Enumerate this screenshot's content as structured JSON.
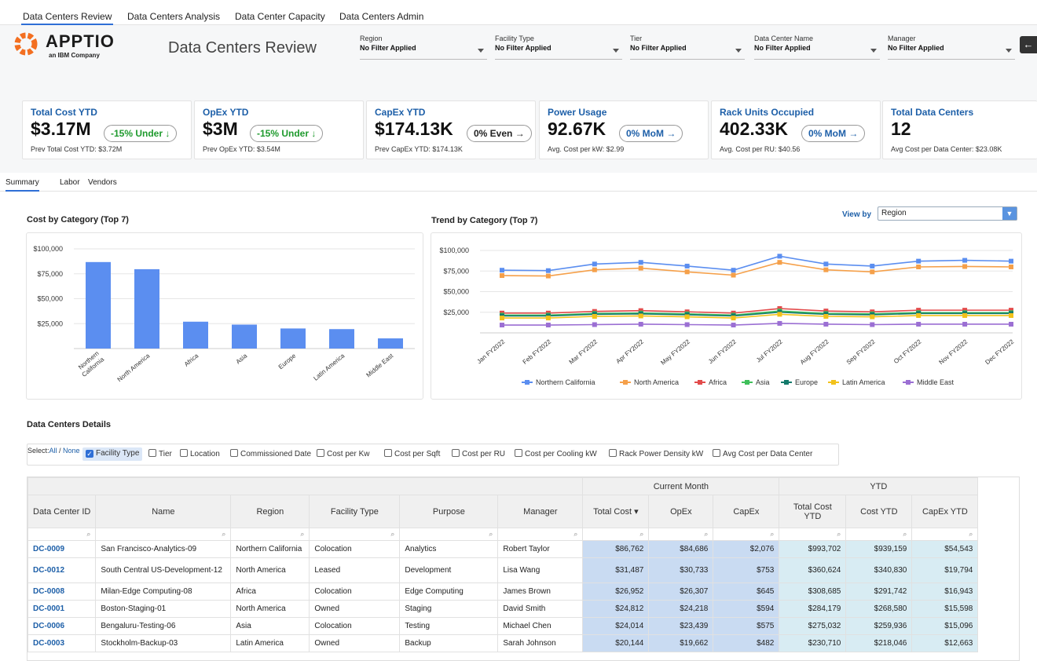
{
  "topnav": {
    "tabs": [
      "Data Centers Review",
      "Data Centers Analysis",
      "Data Center Capacity",
      "Data Centers Admin"
    ],
    "active_index": 0
  },
  "header": {
    "logo_text": "APPTIO",
    "logo_sub": "an IBM Company",
    "title": "Data Centers Review"
  },
  "filters": [
    {
      "label": "Region",
      "value": "No Filter Applied"
    },
    {
      "label": "Facility Type",
      "value": "No Filter Applied"
    },
    {
      "label": "Tier",
      "value": "No Filter Applied"
    },
    {
      "label": "Data Center Name",
      "value": "No Filter Applied"
    },
    {
      "label": "Manager",
      "value": "No Filter Applied"
    }
  ],
  "kpis": [
    {
      "title": "Total Cost YTD",
      "value": "$3.17M",
      "badge": "-15% Under ↓",
      "badge_color": "#1e9a2d",
      "sub": "Prev Total Cost YTD: $3.72M"
    },
    {
      "title": "OpEx YTD",
      "value": "$3M",
      "badge": "-15% Under ↓",
      "badge_color": "#1e9a2d",
      "sub": "Prev OpEx YTD: $3.54M"
    },
    {
      "title": "CapEx YTD",
      "value": "$174.13K",
      "badge": "0% Even →",
      "badge_color": "#222222",
      "sub": "Prev CapEx YTD: $174.13K"
    },
    {
      "title": "Power Usage",
      "value": "92.67K",
      "badge": "0% MoM →",
      "badge_color": "#1d5fa8",
      "sub": "Avg. Cost per kW: $2.99"
    },
    {
      "title": "Rack Units Occupied",
      "value": "402.33K",
      "badge": "0% MoM →",
      "badge_color": "#1d5fa8",
      "sub": "Avg. Cost per RU: $40.56"
    },
    {
      "title": "Total Data Centers",
      "value": "12",
      "badge": "",
      "badge_color": "#222222",
      "sub": "Avg Cost per Data Center: $23.08K"
    }
  ],
  "subtabs": [
    "Summary",
    "Labor",
    "Vendors"
  ],
  "charts_section": {
    "cost_title": "Cost by Category (Top 7)",
    "trend_title": "Trend by Category (Top 7)",
    "viewby_label": "View by",
    "viewby_value": "Region"
  },
  "chart_data": [
    {
      "type": "bar",
      "title": "Cost by Category (Top 7)",
      "categories": [
        "Northern California",
        "North America",
        "Africa",
        "Asia",
        "Europe",
        "Latin America",
        "Middle East"
      ],
      "values": [
        86762,
        79600,
        26952,
        24014,
        20144,
        19500,
        10200
      ],
      "ylim": [
        0,
        100000
      ],
      "yticks": [
        "$25,000",
        "$50,000",
        "$75,000",
        "$100,000"
      ],
      "color": "#5b8ef0"
    },
    {
      "type": "line",
      "title": "Trend by Category (Top 7)",
      "x": [
        "Jan FY2022",
        "Feb FY2022",
        "Mar FY2022",
        "Apr FY2022",
        "May FY2022",
        "Jun FY2022",
        "Jul FY2022",
        "Aug FY2022",
        "Sep FY2022",
        "Oct FY2022",
        "Nov FY2022",
        "Dec FY2022"
      ],
      "ylim": [
        0,
        100000
      ],
      "yticks": [
        "$25,000",
        "$50,000",
        "$75,000",
        "$100,000"
      ],
      "legend": "bottom",
      "series": [
        {
          "name": "Northern California",
          "color": "#5b8ef0",
          "values": [
            76000,
            75500,
            83500,
            85500,
            81000,
            76000,
            93000,
            83500,
            81000,
            87000,
            88000,
            87000
          ]
        },
        {
          "name": "North America",
          "color": "#f5a04a",
          "values": [
            69500,
            69000,
            76500,
            78500,
            74000,
            70000,
            85500,
            76500,
            74000,
            80000,
            80500,
            80000
          ]
        },
        {
          "name": "Africa",
          "color": "#e24b4b",
          "values": [
            24000,
            24000,
            26000,
            27000,
            25500,
            24000,
            29500,
            26500,
            25500,
            27500,
            27500,
            27500
          ]
        },
        {
          "name": "Asia",
          "color": "#3fbf5a",
          "values": [
            21500,
            21500,
            23500,
            24000,
            23000,
            21500,
            26500,
            23500,
            23000,
            24500,
            24500,
            24500
          ]
        },
        {
          "name": "Europe",
          "color": "#137a6b",
          "values": [
            20500,
            20500,
            22500,
            23000,
            22000,
            20500,
            25000,
            22500,
            22000,
            23500,
            23500,
            23500
          ]
        },
        {
          "name": "Latin America",
          "color": "#f2c21b",
          "values": [
            18000,
            18000,
            20000,
            20500,
            19500,
            18000,
            22500,
            20000,
            19500,
            21000,
            21000,
            21000
          ]
        },
        {
          "name": "Middle East",
          "color": "#9b6fd3",
          "values": [
            9500,
            9500,
            10000,
            10500,
            10000,
            9500,
            11500,
            10500,
            10000,
            10500,
            10500,
            10500
          ]
        }
      ]
    }
  ],
  "details": {
    "title": "Data Centers Details",
    "select_label": "Select:",
    "select_all": "All",
    "select_sep": " / ",
    "select_none": "None",
    "columns": [
      {
        "label": "Facility Type",
        "checked": true
      },
      {
        "label": "Tier",
        "checked": false
      },
      {
        "label": "Location",
        "checked": false
      },
      {
        "label": "Commissioned Date",
        "checked": false
      },
      {
        "label": "Cost per Kw",
        "checked": false
      },
      {
        "label": "Cost per Sqft",
        "checked": false
      },
      {
        "label": "Cost per RU",
        "checked": false
      },
      {
        "label": "Cost per Cooling kW",
        "checked": false
      },
      {
        "label": "Rack Power Density kW",
        "checked": false
      },
      {
        "label": "Avg Cost per Data Center",
        "checked": false
      }
    ]
  },
  "table": {
    "group_current": "Current Month",
    "group_ytd": "YTD",
    "headers": [
      "Data Center ID",
      "Name",
      "Region",
      "Facility Type",
      "Purpose",
      "Manager",
      "Total Cost ▾",
      "OpEx",
      "CapEx",
      "Total Cost YTD",
      "Cost YTD",
      "CapEx YTD"
    ],
    "rows": [
      [
        "DC-0009",
        "San Francisco-Analytics-09",
        "Northern California",
        "Colocation",
        "Analytics",
        "Robert Taylor",
        "$86,762",
        "$84,686",
        "$2,076",
        "$993,702",
        "$939,159",
        "$54,543"
      ],
      [
        "DC-0012",
        "South Central US-Development-12",
        "North America",
        "Leased",
        "Development",
        "Lisa Wang",
        "$31,487",
        "$30,733",
        "$753",
        "$360,624",
        "$340,830",
        "$19,794"
      ],
      [
        "DC-0008",
        "Milan-Edge Computing-08",
        "Africa",
        "Colocation",
        "Edge Computing",
        "James Brown",
        "$26,952",
        "$26,307",
        "$645",
        "$308,685",
        "$291,742",
        "$16,943"
      ],
      [
        "DC-0001",
        "Boston-Staging-01",
        "North America",
        "Owned",
        "Staging",
        "David Smith",
        "$24,812",
        "$24,218",
        "$594",
        "$284,179",
        "$268,580",
        "$15,598"
      ],
      [
        "DC-0006",
        "Bengaluru-Testing-06",
        "Asia",
        "Colocation",
        "Testing",
        "Michael Chen",
        "$24,014",
        "$23,439",
        "$575",
        "$275,032",
        "$259,936",
        "$15,096"
      ],
      [
        "DC-0003",
        "Stockholm-Backup-03",
        "Latin America",
        "Owned",
        "Backup",
        "Sarah Johnson",
        "$20,144",
        "$19,662",
        "$482",
        "$230,710",
        "$218,046",
        "$12,663"
      ]
    ]
  }
}
